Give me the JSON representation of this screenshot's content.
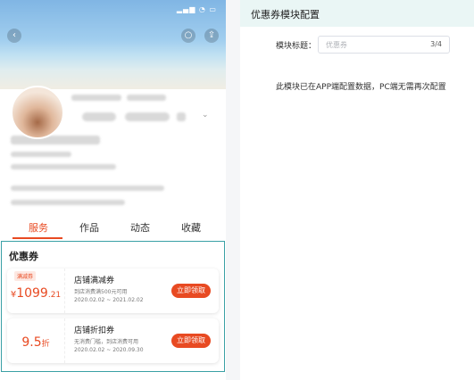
{
  "phone": {
    "tabs": [
      "服务",
      "作品",
      "动态",
      "收藏"
    ],
    "coupon_module": {
      "title": "优惠券",
      "coupons": [
        {
          "badge": "满减券",
          "currency": "¥",
          "amount_main": "1099",
          "amount_decimal": ".21",
          "name": "店铺满减券",
          "condition": "到店消费满500元可用",
          "validity": "2020.02.02 ~ 2021.02.02",
          "button": "立即领取"
        },
        {
          "badge": "",
          "amount_main": "9.5",
          "amount_unit": "折",
          "name": "店铺折扣券",
          "condition": "无消费门槛，到店消费可用",
          "validity": "2020.02.02 ~ 2020.09.30",
          "button": "立即领取"
        }
      ]
    }
  },
  "panel": {
    "title": "优惠券模块配置",
    "field_label": "模块标题：",
    "field_value": "优惠券",
    "field_counter": "3/4",
    "notice": "此模块已在APP端配置数据，PC端无需再次配置"
  },
  "colors": {
    "accent": "#e84a22",
    "module_border": "#3aa0a5",
    "header_bg": "#eaf6f5"
  }
}
